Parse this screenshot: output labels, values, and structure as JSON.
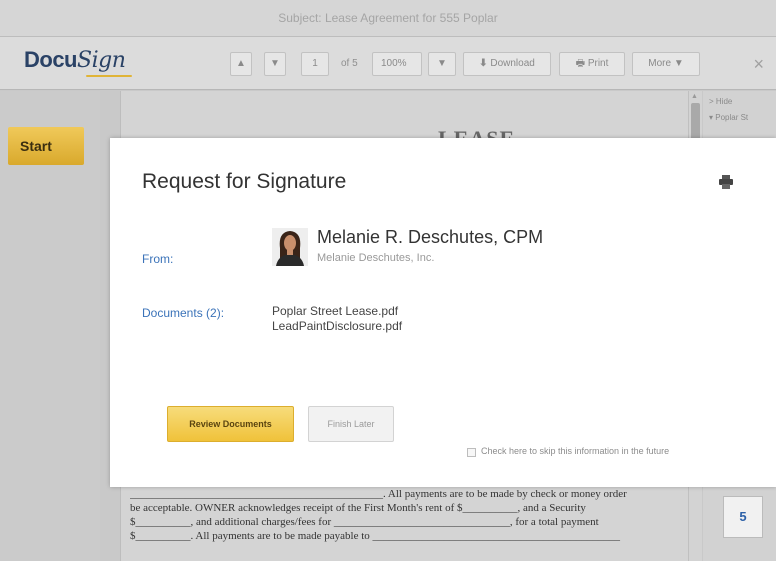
{
  "window": {
    "title": "Subject: Lease Agreement for 555 Poplar"
  },
  "toolbar": {
    "logo_prefix": "Docu",
    "logo_suffix": "Sign",
    "page_input": "1",
    "page_of": "of 5",
    "zoom": "100%",
    "download_label": "Download",
    "print_label": "Print",
    "more_label": "More",
    "close_symbol": "×"
  },
  "left": {
    "start_label": "Start"
  },
  "document": {
    "heading": "LEASE",
    "lines": [
      "______________________________________________. All payments are to be made by check or money order",
      "be acceptable. OWNER acknowledges receipt of the First Month's rent of $__________, and a Security",
      "$__________, and additional charges/fees for ________________________________, for a total payment",
      "$__________. All payments are to be made payable to _____________________________________________"
    ]
  },
  "right_panel": {
    "hide_label": "> Hide",
    "folder_label": "▾ Poplar St",
    "page_thumb": "5"
  },
  "modal": {
    "title": "Request for Signature",
    "from_label": "From:",
    "sender_name": "Melanie R. Deschutes, CPM",
    "sender_org": "Melanie Deschutes, Inc.",
    "documents_label": "Documents (2):",
    "documents": [
      "Poplar Street Lease.pdf",
      "LeadPaintDisclosure.pdf"
    ],
    "review_label": "Review Documents",
    "finish_label": "Finish Later",
    "skip_label": "Check here to skip this information in the future"
  },
  "colors": {
    "accent": "#f0c23a",
    "link": "#3b73b9",
    "brand": "#2a4266"
  }
}
